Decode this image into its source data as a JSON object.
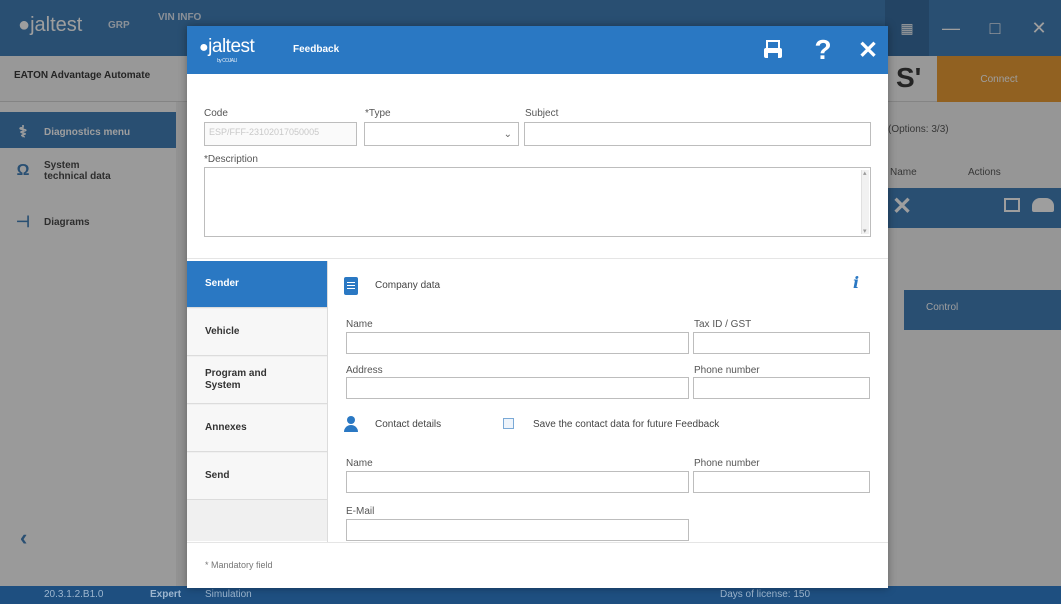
{
  "background": {
    "logo": "jaltest",
    "top_buttons": [
      "GRP"
    ],
    "vin_label": "VIN INFO",
    "model": "EATON Advantage Automate",
    "connect_label": "Connect",
    "sidebar": {
      "diagnostics_menu": "Diagnostics menu",
      "system_technical_data": "System technical data",
      "diagrams": "Diagrams"
    },
    "options": "(Options: 3/3)",
    "name_col": "Name",
    "actions_col": "Actions",
    "control_label": "Control",
    "status": {
      "version": "20.3.1.2.B1.0",
      "mode": "Expert",
      "simulation": "Simulation",
      "days": "Days of license: 150"
    }
  },
  "dialog": {
    "logo": "jaltest",
    "logo_sub": "by COJALI",
    "title": "Feedback",
    "header_icons": [
      "printer-icon",
      "help-icon",
      "close-icon"
    ],
    "code_label": "Code",
    "code_value": "ESP/FFF-23102017050005",
    "type_label": "*Type",
    "subject_label": "Subject",
    "description_label": "*Description",
    "nav": [
      {
        "label": "Sender",
        "active": true
      },
      {
        "label": "Vehicle",
        "active": false
      },
      {
        "label": "Program and System",
        "active": false
      },
      {
        "label": "Annexes",
        "active": false
      },
      {
        "label": "Send",
        "active": false
      }
    ],
    "company_section": "Company data",
    "company_fields": {
      "name": "Name",
      "tax_id": "Tax ID / GST",
      "address": "Address",
      "phone": "Phone number"
    },
    "contact_section": "Contact details",
    "save_contact_label": "Save the contact data for future Feedback",
    "contact_fields": {
      "name": "Name",
      "phone": "Phone number",
      "email": "E-Mail"
    },
    "mandatory_note": "* Mandatory field"
  }
}
